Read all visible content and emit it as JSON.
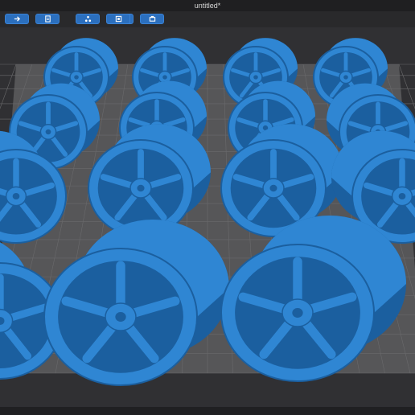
{
  "window": {
    "title": "untitled*"
  },
  "toolbar": {
    "buttons": [
      {
        "icon": "import-icon"
      },
      {
        "icon": "open-file-icon"
      },
      {
        "icon": "support-icon"
      },
      {
        "icon": "resin-bottle-icon"
      },
      {
        "icon": "layer-frame-icon"
      },
      {
        "icon": "printer-icon"
      }
    ]
  },
  "colors": {
    "model": "#2f86d3",
    "model_shade": "#1b5f9f",
    "plate": "#565658",
    "grid": "#6a6a6c",
    "background": "#303033",
    "toolbar_button": "#2b6fbe"
  }
}
